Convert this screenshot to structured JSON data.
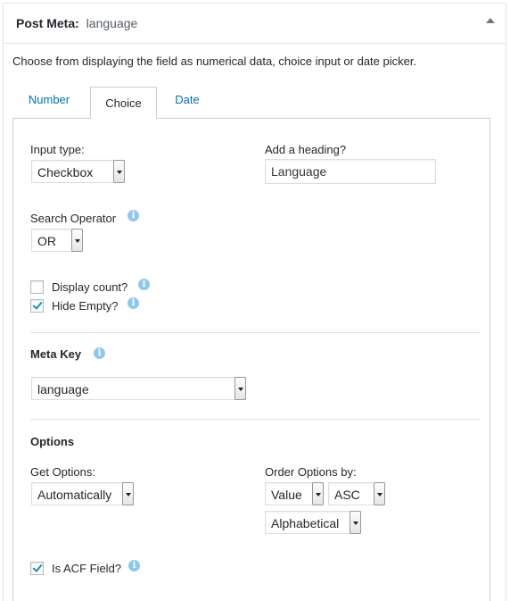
{
  "header": {
    "title": "Post Meta:",
    "field_name": "language"
  },
  "description": "Choose from displaying the field as numerical data, choice input or date picker.",
  "tabs": [
    {
      "label": "Number",
      "active": false
    },
    {
      "label": "Choice",
      "active": true
    },
    {
      "label": "Date",
      "active": false
    }
  ],
  "choice": {
    "input_type_label": "Input type:",
    "input_type_value": "Checkbox",
    "heading_label": "Add a heading?",
    "heading_value": "Language",
    "search_operator_label": "Search Operator",
    "search_operator_value": "OR",
    "display_count_label": "Display count?",
    "display_count_checked": false,
    "hide_empty_label": "Hide Empty?",
    "hide_empty_checked": true,
    "meta_key_label": "Meta Key",
    "meta_key_value": "language",
    "options_label": "Options",
    "get_options_label": "Get Options:",
    "get_options_value": "Automatically",
    "order_options_label": "Order Options by:",
    "order_by_value": "Value",
    "order_dir_value": "ASC",
    "order_type_value": "Alphabetical",
    "is_acf_label": "Is ACF Field?",
    "is_acf_checked": true
  },
  "icons": {
    "info": "i",
    "info_color": "#8fc8ea",
    "check_color": "#1e8cbe",
    "link_color": "#0073aa"
  }
}
